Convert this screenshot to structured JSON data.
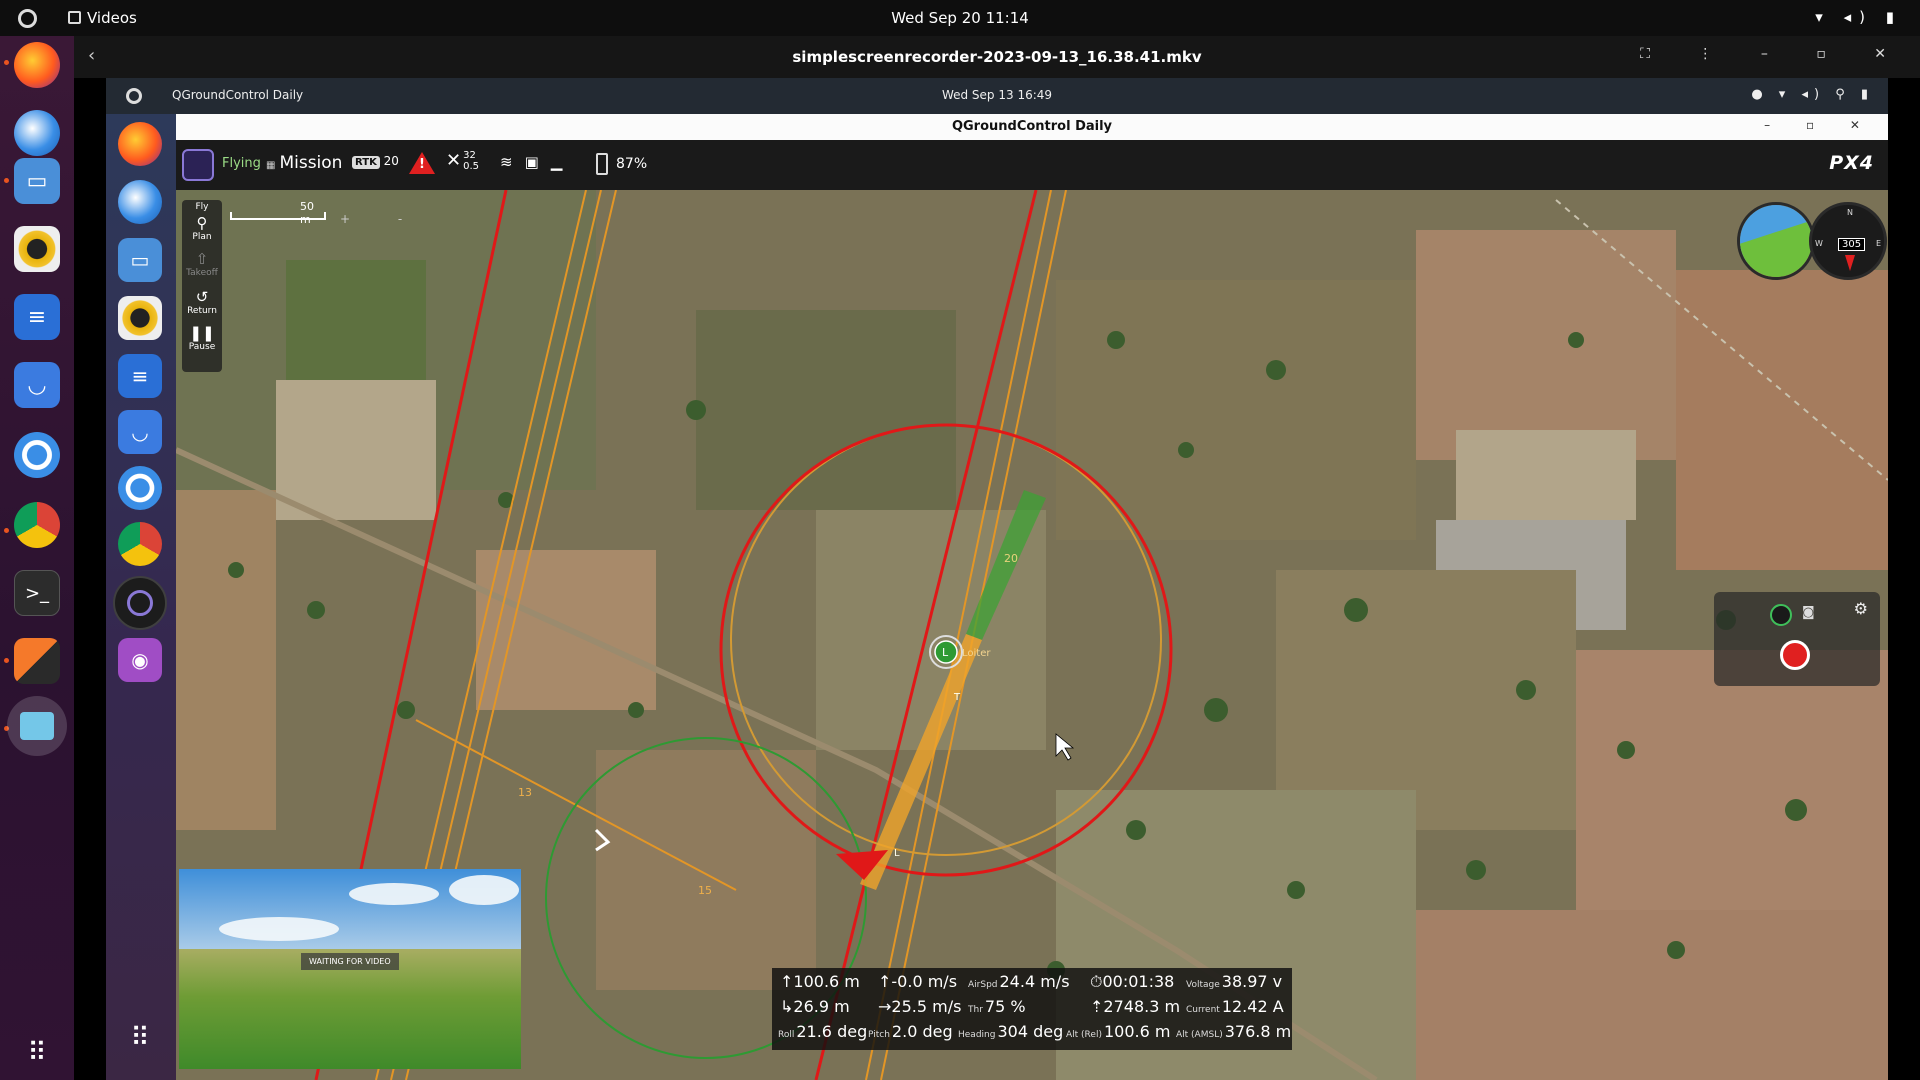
{
  "top_bar": {
    "app_name": "Videos",
    "clock": "Wed Sep 20  11:14",
    "tray": "▾ ◂) ▮"
  },
  "dock": {
    "items": [
      "firefox",
      "thunderbird",
      "files",
      "rhythmbox",
      "libreoffice-writer",
      "software-center",
      "help",
      "chrome",
      "terminal",
      "blender",
      "videos",
      "show-apps"
    ]
  },
  "video_window": {
    "title": "simplescreenrecorder-2023-09-13_16.38.41.mkv",
    "back_label": "‹",
    "controls": "⛶ ⋮ – ▫ ✕"
  },
  "inner_desktop": {
    "app_name": "QGroundControl Daily",
    "clock": "Wed Sep 13  16:49",
    "tray": "● ▾ ◂) ⚲ ▮"
  },
  "qgc": {
    "window_title": "QGroundControl Daily",
    "window_controls": "– ▫ ✕",
    "toolbar": {
      "flight_status": "Flying",
      "flight_mode": "Mission",
      "rtk_label": "RTK",
      "rtk_count": "20",
      "gps_sats": "32",
      "gps_hdop": "0.5",
      "battery": "87%",
      "brand": "PX4"
    },
    "fly_tools": [
      {
        "label": "Plan",
        "icon": "plan-icon",
        "enabled": true
      },
      {
        "label": "Takeoff",
        "icon": "takeoff-icon",
        "enabled": false
      },
      {
        "label": "Return",
        "icon": "return-icon",
        "enabled": true
      },
      {
        "label": "Pause",
        "icon": "pause-icon",
        "enabled": true
      }
    ],
    "fly_tools_header": "Fly",
    "scale_label": "50 m",
    "zoom": "+ -",
    "compass_heading": "305",
    "map_labels": {
      "loiter": "Loiter",
      "marker_l": "L",
      "wp20": "20",
      "wp13": "13",
      "wp15": "15",
      "t": "T"
    },
    "video_status": "WAITING FOR VIDEO",
    "telemetry": [
      {
        "label": "",
        "value": "↑100.6 m"
      },
      {
        "label": "",
        "value": "↑-0.0 m/s"
      },
      {
        "label": "AirSpd",
        "value": "24.4 m/s"
      },
      {
        "label": "",
        "value": "⏱00:01:38"
      },
      {
        "label": "Voltage",
        "value": "38.97 v"
      },
      {
        "label": "",
        "value": "↳26.9 m"
      },
      {
        "label": "",
        "value": "→25.5 m/s"
      },
      {
        "label": "Thr",
        "value": "75 %"
      },
      {
        "label": "",
        "value": "⇡2748.3 m"
      },
      {
        "label": "Current",
        "value": "12.42 A"
      },
      {
        "label": "Roll",
        "value": "21.6 deg"
      },
      {
        "label": "Pitch",
        "value": "2.0 deg"
      },
      {
        "label": "Heading",
        "value": "304 deg"
      },
      {
        "label": "Alt (Rel)",
        "value": "100.6 m"
      },
      {
        "label": "Alt (AMSL)",
        "value": "376.8 m"
      }
    ]
  }
}
